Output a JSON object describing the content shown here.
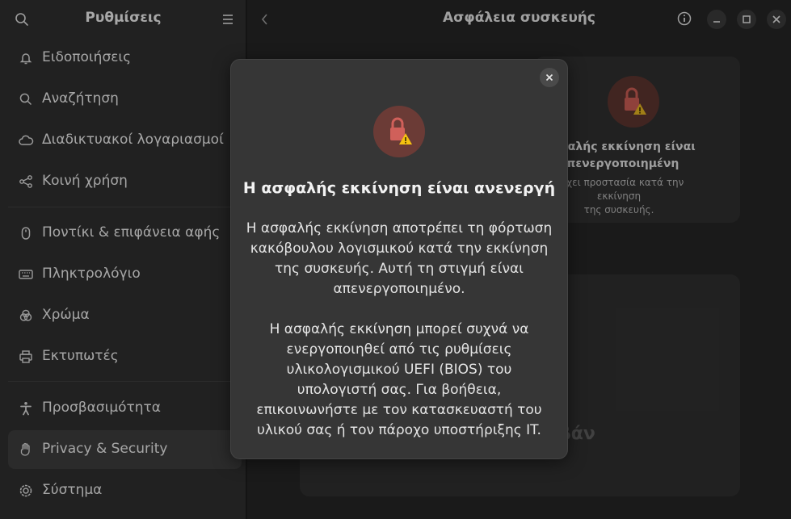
{
  "sidebar": {
    "title": "Ρυθμίσεις",
    "items": [
      {
        "label": "Ειδοποιήσεις",
        "icon": "bell-icon"
      },
      {
        "label": "Αναζήτηση",
        "icon": "search-icon"
      },
      {
        "label": "Διαδικτυακοί λογαριασμοί",
        "icon": "cloud-icon"
      },
      {
        "label": "Κοινή χρήση",
        "icon": "share-icon"
      },
      {
        "label": "Ποντίκι & επιφάνεια αφής",
        "icon": "mouse-icon"
      },
      {
        "label": "Πληκτρολόγιο",
        "icon": "keyboard-icon"
      },
      {
        "label": "Χρώμα",
        "icon": "color-icon"
      },
      {
        "label": "Εκτυπωτές",
        "icon": "printer-icon"
      },
      {
        "label": "Προσβασιμότητα",
        "icon": "accessibility-icon"
      },
      {
        "label": "Privacy & Security",
        "icon": "hand-icon"
      },
      {
        "label": "Σύστημα",
        "icon": "gear-icon"
      }
    ]
  },
  "header": {
    "title": "Ασφάλεια συσκευής"
  },
  "card": {
    "title_line1": "ασφαλής εκκίνηση είναι",
    "title_line2": "απενεργοποιημένη",
    "sub_line1": "άρχει προστασία κατά την εκκίνηση",
    "sub_line2": "της συσκευής.",
    "lower_partial": "βάν"
  },
  "dialog": {
    "title": "Η ασφαλής εκκίνηση είναι ανενεργή",
    "para1": "Η ασφαλής εκκίνηση αποτρέπει τη φόρτωση κακόβουλου λογισμικού κατά την εκκίνηση της συσκευής. Αυτή τη στιγμή είναι απενεργοποιημένο.",
    "para2": "Η ασφαλής εκκίνηση μπορεί συχνά να ενεργοποιηθεί από τις ρυθμίσεις υλικολογισμικού UEFI (BIOS) του υπολογιστή σας. Για βοήθεια, επικοινωνήστε με τον κατασκευαστή του υλικού σας ή τον πάροχο υποστήριξης IT."
  },
  "colors": {
    "accent_lock_bg": "#6b3b36",
    "lock_red": "#d0605a",
    "warning_yellow": "#f5c211"
  }
}
